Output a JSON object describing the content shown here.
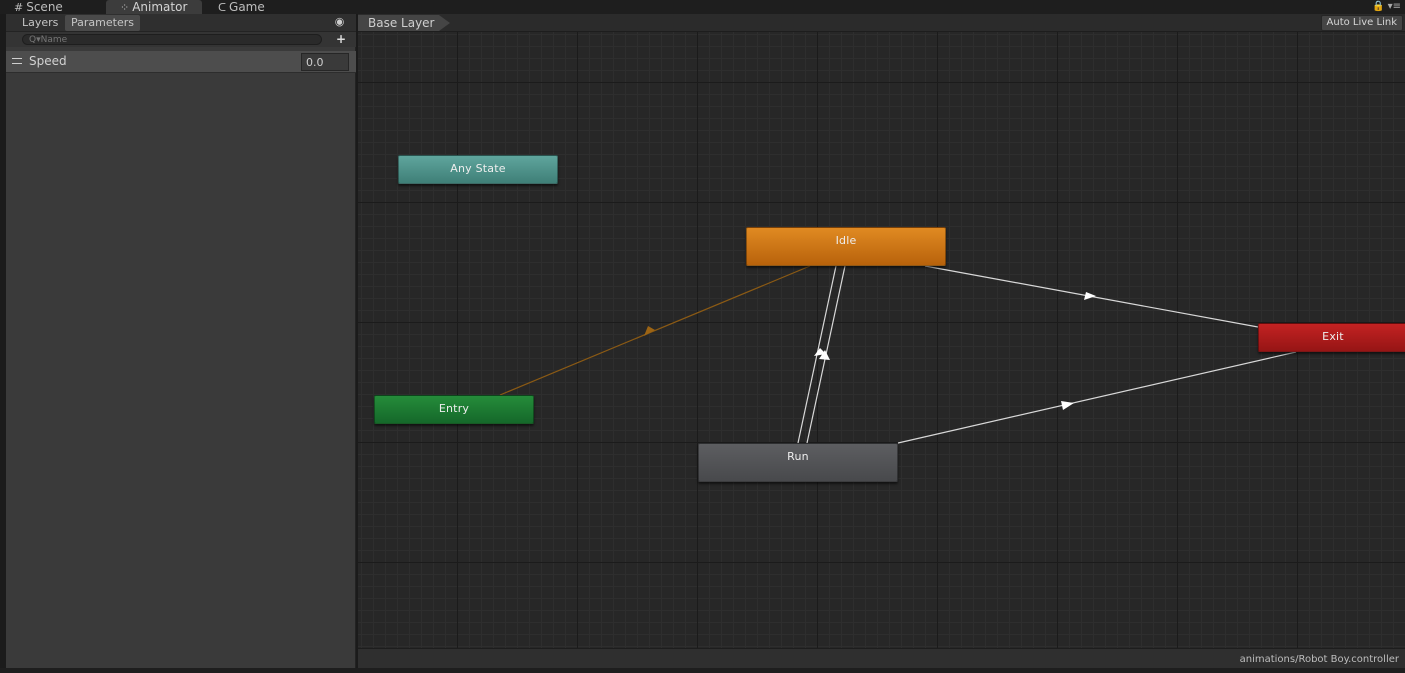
{
  "window_tabs": [
    {
      "label": "Scene",
      "icon": "grid-icon"
    },
    {
      "label": "Animator",
      "icon": "animator-icon"
    },
    {
      "label": "Game",
      "icon": "pacman-icon"
    }
  ],
  "window_controls": {
    "lock": "🔒",
    "menu": "▾≡"
  },
  "left_panel": {
    "tabs": [
      "Layers",
      "Parameters"
    ],
    "active_tab": "Parameters",
    "eye_icon": "◉",
    "search_placeholder": "Q▾Name",
    "add_label": "+",
    "parameters": [
      {
        "name": "Speed",
        "value": "0.0"
      }
    ]
  },
  "graph": {
    "breadcrumb": "Base Layer",
    "auto_live_link": "Auto Live Link",
    "states": {
      "any_state": "Any State",
      "idle": "Idle",
      "entry": "Entry",
      "run": "Run",
      "exit": "Exit"
    }
  },
  "colors": {
    "any_state": "#4f928a",
    "idle": "#cc7516",
    "entry": "#1d7a32",
    "run": "#535457",
    "exit": "#ad1b1b",
    "entry_transition": "#8b5a14",
    "transition": "#d8d8d8"
  },
  "status": {
    "controller_path": "animations/Robot Boy.controller"
  }
}
